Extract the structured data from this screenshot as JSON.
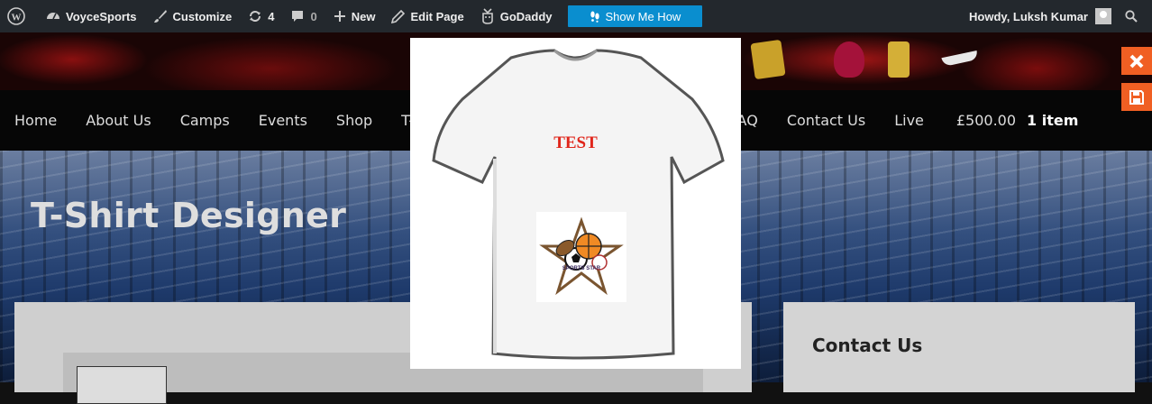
{
  "adminbar": {
    "site_name": "VoyceSports",
    "customize": "Customize",
    "updates": "4",
    "comments": "0",
    "new": "New",
    "edit_page": "Edit Page",
    "godaddy": "GoDaddy",
    "show_me_how": "Show Me How",
    "greeting": "Howdy, Luksh Kumar"
  },
  "nav": {
    "items": [
      "Home",
      "About Us",
      "Camps",
      "Events",
      "Shop",
      "T-Sh",
      "AQ",
      "Contact Us",
      "Live"
    ],
    "cart_total": "£500.00",
    "cart_count": "1 item"
  },
  "hero": {
    "title": "T-Shirt Designer"
  },
  "sidebar": {
    "title": "Contact Us"
  },
  "preview": {
    "tshirt_text": "TEST",
    "logo_text": "SPORTS STAR"
  },
  "colors": {
    "admin_bar": "#23282d",
    "show_me_how": "#0a8ecf",
    "orange": "#f05f23",
    "tshirt_text": "#e0261b"
  },
  "icons": [
    "wordpress-icon",
    "dashboard-icon",
    "brush-icon",
    "refresh-icon",
    "comment-icon",
    "plus-icon",
    "pencil-icon",
    "godaddy-icon",
    "footprint-icon",
    "search-icon",
    "close-icon",
    "save-icon"
  ]
}
